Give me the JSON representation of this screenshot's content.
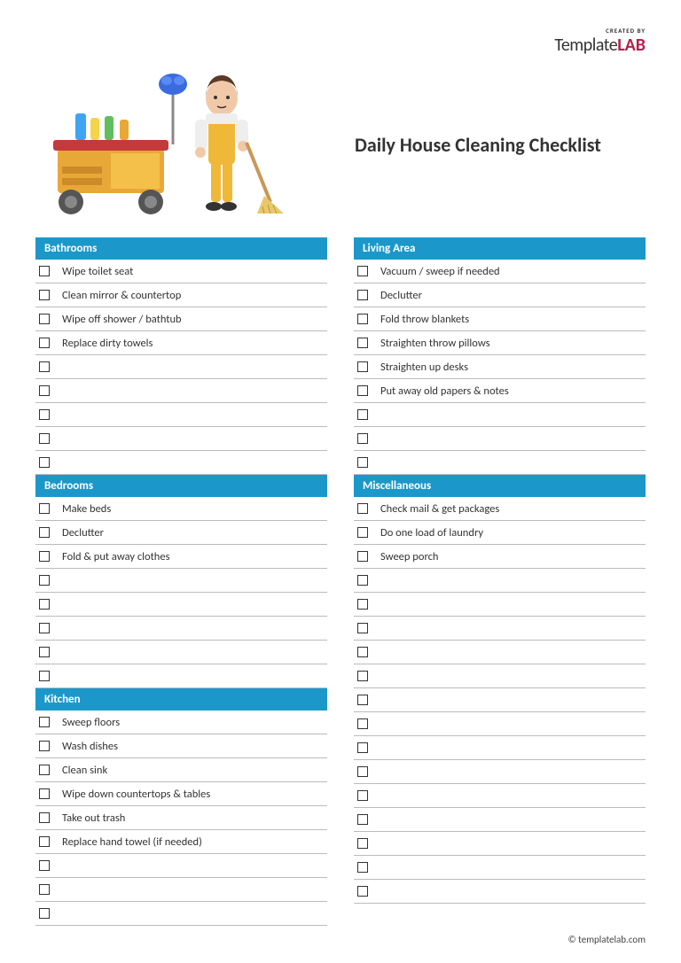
{
  "branding": {
    "created_by": "CREATED BY",
    "logo_template": "Template",
    "logo_lab": "LAB"
  },
  "title": "Daily House Cleaning Checklist",
  "footer": "© templatelab.com",
  "columns": [
    [
      {
        "title": "Bathrooms",
        "rows": 9,
        "items": [
          "Wipe toilet seat",
          "Clean mirror & countertop",
          "Wipe off shower / bathtub",
          "Replace dirty towels"
        ]
      },
      {
        "title": "Bedrooms",
        "rows": 8,
        "items": [
          "Make beds",
          "Declutter",
          "Fold & put away clothes"
        ]
      },
      {
        "title": "Kitchen",
        "rows": 9,
        "items": [
          "Sweep floors",
          "Wash dishes",
          "Clean sink",
          "Wipe down countertops & tables",
          "Take out trash",
          "Replace hand towel (if needed)"
        ]
      }
    ],
    [
      {
        "title": "Living Area",
        "rows": 9,
        "items": [
          "Vacuum / sweep if needed",
          "Declutter",
          "Fold throw blankets",
          "Straighten throw pillows",
          "Straighten up desks",
          "Put away old papers & notes"
        ]
      },
      {
        "title": "Miscellaneous",
        "rows": 17,
        "items": [
          "Check mail & get packages",
          "Do one load of laundry",
          "Sweep porch"
        ]
      }
    ]
  ]
}
